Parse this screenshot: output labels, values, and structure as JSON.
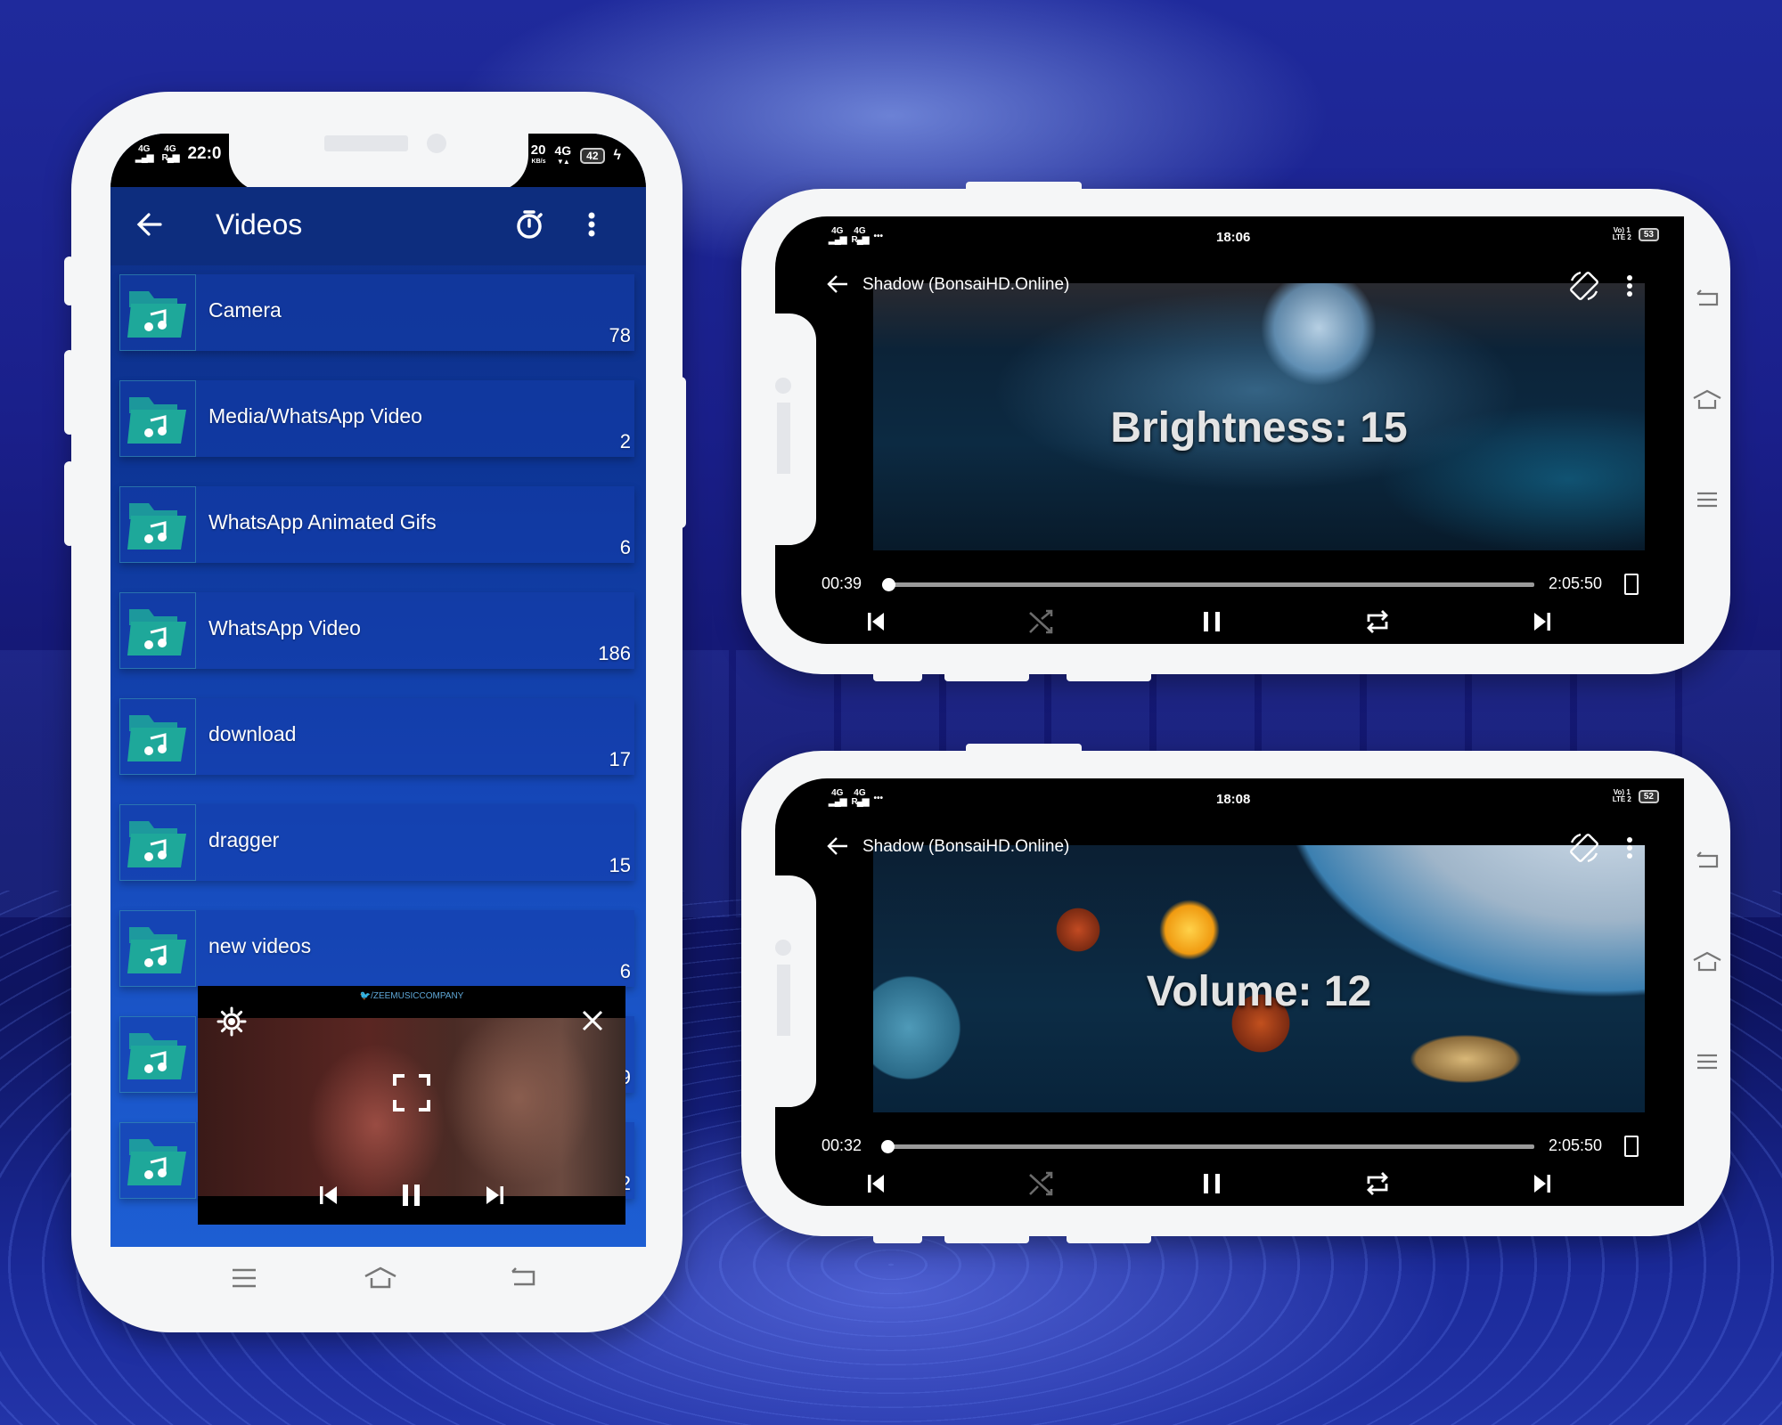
{
  "phones": {
    "portrait": {
      "status_bar": {
        "signal_1": "4G",
        "signal_2": "4G",
        "time": "22:0",
        "net_speed": "20",
        "net_speed_unit": "KB/s",
        "net_type": "4G",
        "battery": "42"
      },
      "app_bar": {
        "title": "Videos",
        "back_icon": "arrow-left-icon",
        "timer_icon": "timer-icon",
        "more_icon": "more-vert-icon"
      },
      "folders": [
        {
          "name": "Camera",
          "count": "78"
        },
        {
          "name": "Media/WhatsApp Video",
          "count": "2"
        },
        {
          "name": "WhatsApp Animated Gifs",
          "count": "6"
        },
        {
          "name": "WhatsApp Video",
          "count": "186"
        },
        {
          "name": "download",
          "count": "17"
        },
        {
          "name": "dragger",
          "count": "15"
        },
        {
          "name": "new videos",
          "count": "6"
        },
        {
          "name": "",
          "count": "9"
        },
        {
          "name": "",
          "count": "2"
        }
      ],
      "mini_player": {
        "watermark": "/ZEEMUSICCOMPANY",
        "settings_icon": "gear-icon",
        "close_icon": "close-icon",
        "fullscreen_icon": "fullscreen-icon",
        "prev_icon": "skip-previous-icon",
        "pause_icon": "pause-icon",
        "next_icon": "skip-next-icon"
      },
      "nav_bar": [
        "menu-icon",
        "home-icon",
        "back-icon"
      ]
    },
    "landscape_top": {
      "status_bar": {
        "signal_1": "4G",
        "signal_2": "4G",
        "dots": "•••",
        "time": "18:06",
        "volte_1": "Vo) 1",
        "volte_2": "LTE 2",
        "battery": "53"
      },
      "video_title": "Shadow (BonsaiHD.Online)",
      "overlay": "Brightness: 15",
      "brightness": 15,
      "current_time": "00:39",
      "total_time": "2:05:50",
      "progress_fraction": 0.005
    },
    "landscape_bottom": {
      "status_bar": {
        "signal_1": "4G",
        "signal_2": "4G",
        "dots": "•••",
        "time": "18:08",
        "volte_1": "Vo) 1",
        "volte_2": "LTE 2",
        "battery": "52"
      },
      "video_title": "Shadow (BonsaiHD.Online)",
      "overlay": "Volume: 12",
      "volume": 12,
      "current_time": "00:32",
      "total_time": "2:05:50",
      "progress_fraction": 0.004
    }
  },
  "colors": {
    "app_bar": "#0d2d7e",
    "folder_icon": "#1ea89a",
    "shuffle_disabled": "#6b6b6b"
  }
}
